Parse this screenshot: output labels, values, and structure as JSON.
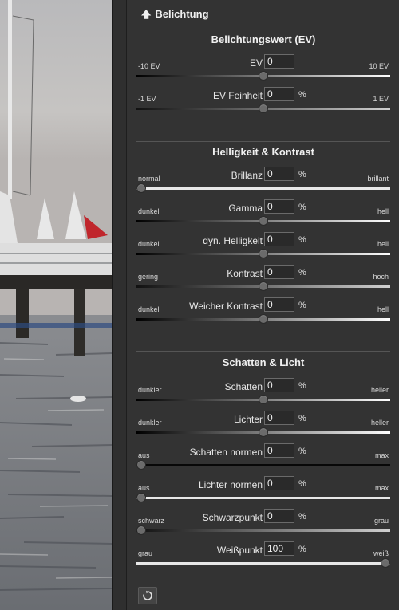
{
  "panel_title": "Belichtung",
  "sections": [
    {
      "title": "Belichtungswert (EV)",
      "sliders": [
        {
          "name": "EV",
          "value": "0",
          "unit": "",
          "min_label": "-10 EV",
          "max_label": "10 EV",
          "position": 0.5,
          "track": "dark-light"
        },
        {
          "name": "EV Feinheit",
          "value": "0",
          "unit": "%",
          "min_label": "-1 EV",
          "max_label": "1 EV",
          "position": 0.5,
          "track": "gray"
        }
      ]
    },
    {
      "title": "Helligkeit & Kontrast",
      "sliders": [
        {
          "name": "Brillanz",
          "value": "0",
          "unit": "%",
          "min_label": "normal",
          "max_label": "brillant",
          "position": 0.0,
          "track": "white"
        },
        {
          "name": "Gamma",
          "value": "0",
          "unit": "%",
          "min_label": "dunkel",
          "max_label": "hell",
          "position": 0.5,
          "track": "dark-light"
        },
        {
          "name": "dyn. Helligkeit",
          "value": "0",
          "unit": "%",
          "min_label": "dunkel",
          "max_label": "hell",
          "position": 0.5,
          "track": "dark-light"
        },
        {
          "name": "Kontrast",
          "value": "0",
          "unit": "%",
          "min_label": "gering",
          "max_label": "hoch",
          "position": 0.5,
          "track": "gray"
        },
        {
          "name": "Weicher Kontrast",
          "value": "0",
          "unit": "%",
          "min_label": "dunkel",
          "max_label": "hell",
          "position": 0.5,
          "track": "dark-light"
        }
      ]
    },
    {
      "title": "Schatten & Licht",
      "sliders": [
        {
          "name": "Schatten",
          "value": "0",
          "unit": "%",
          "min_label": "dunkler",
          "max_label": "heller",
          "position": 0.5,
          "track": "dark-light"
        },
        {
          "name": "Lichter",
          "value": "0",
          "unit": "%",
          "min_label": "dunkler",
          "max_label": "heller",
          "position": 0.5,
          "track": "dark-light"
        },
        {
          "name": "Schatten normen",
          "value": "0",
          "unit": "%",
          "min_label": "aus",
          "max_label": "max",
          "position": 0.0,
          "track": "black"
        },
        {
          "name": "Lichter normen",
          "value": "0",
          "unit": "%",
          "min_label": "aus",
          "max_label": "max",
          "position": 0.0,
          "track": "white"
        },
        {
          "name": "Schwarzpunkt",
          "value": "0",
          "unit": "%",
          "min_label": "schwarz",
          "max_label": "grau",
          "position": 0.0,
          "track": "gray"
        },
        {
          "name": "Weißpunkt",
          "value": "100",
          "unit": "%",
          "min_label": "grau",
          "max_label": "weiß",
          "position": 1.0,
          "track": "white"
        }
      ]
    }
  ],
  "icons": {
    "collapse": "arrow-up-icon",
    "reset": "reset-icon"
  }
}
